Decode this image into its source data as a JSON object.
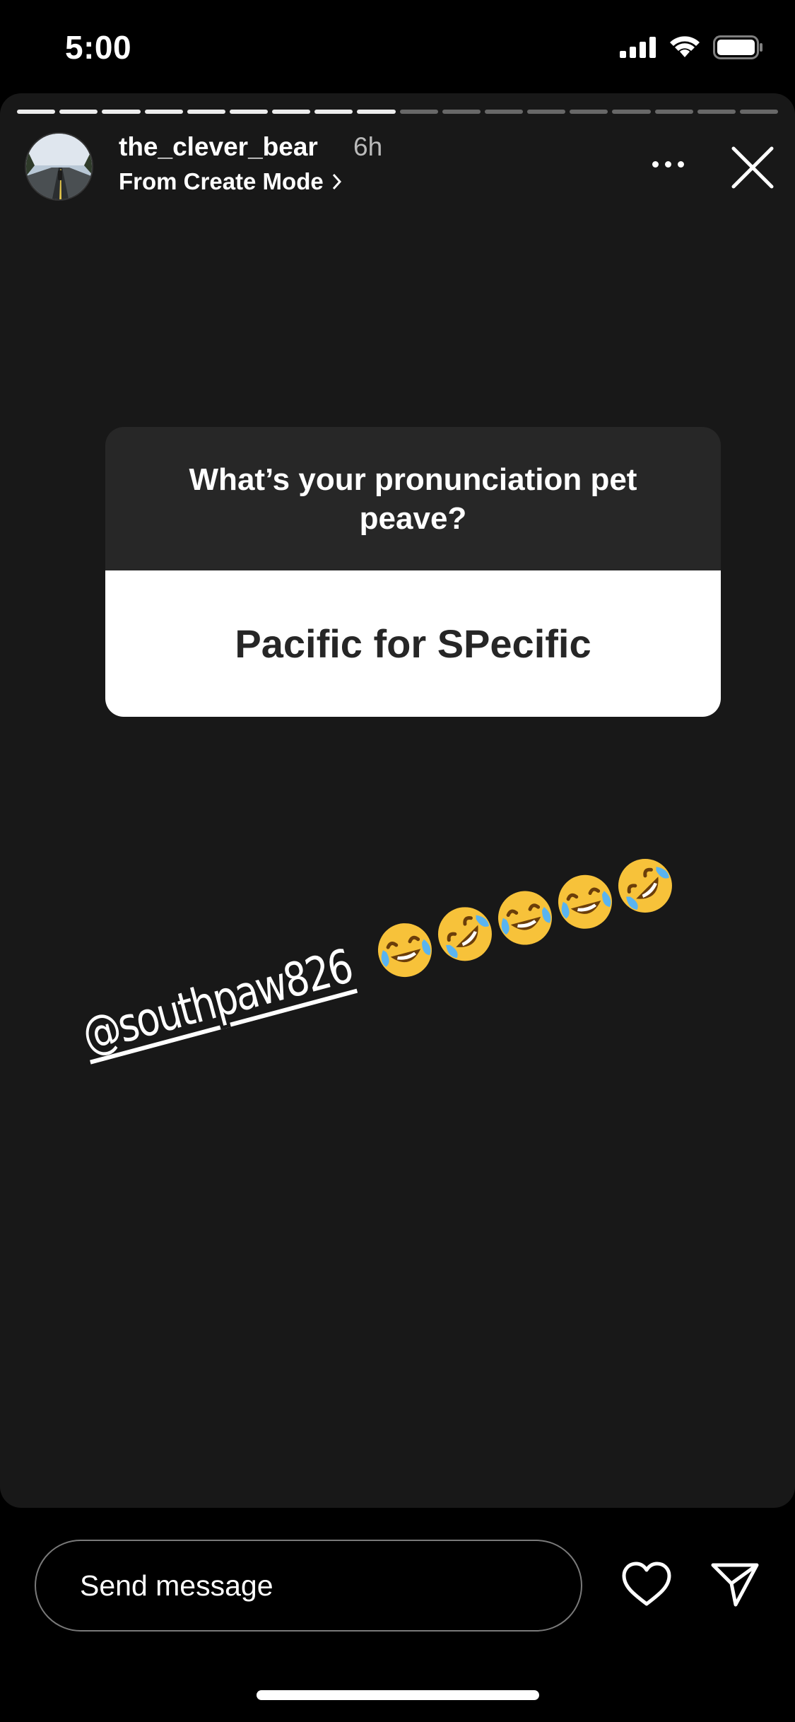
{
  "status_bar": {
    "time": "5:00",
    "icons": [
      "signal-icon",
      "wifi-icon",
      "battery-icon"
    ]
  },
  "story": {
    "progress": {
      "total_segments": 18,
      "completed_segments": 9
    },
    "header": {
      "username": "the_clever_bear",
      "time_ago": "6h",
      "subtitle": "From Create Mode",
      "subtitle_icon": "chevron-right-icon",
      "more_icon": "more-options-icon",
      "close_icon": "close-icon"
    },
    "question_sticker": {
      "question": "What’s your pronunciation pet peave?",
      "answer": "Pacific for SPecific"
    },
    "mention": {
      "text": "@southpaw826",
      "emojis": [
        "face-with-tears-of-joy",
        "rolling-on-floor-laughing",
        "face-with-tears-of-joy",
        "face-with-tears-of-joy",
        "rolling-on-floor-laughing"
      ]
    }
  },
  "footer": {
    "message_placeholder": "Send message",
    "heart_icon": "heart-icon",
    "send_icon": "send-icon"
  },
  "colors": {
    "background": "#000000",
    "story_background": "#181818",
    "sticker_header": "#272727",
    "sticker_answer": "#ffffff",
    "emoji_yellow": "#f7c23a"
  }
}
